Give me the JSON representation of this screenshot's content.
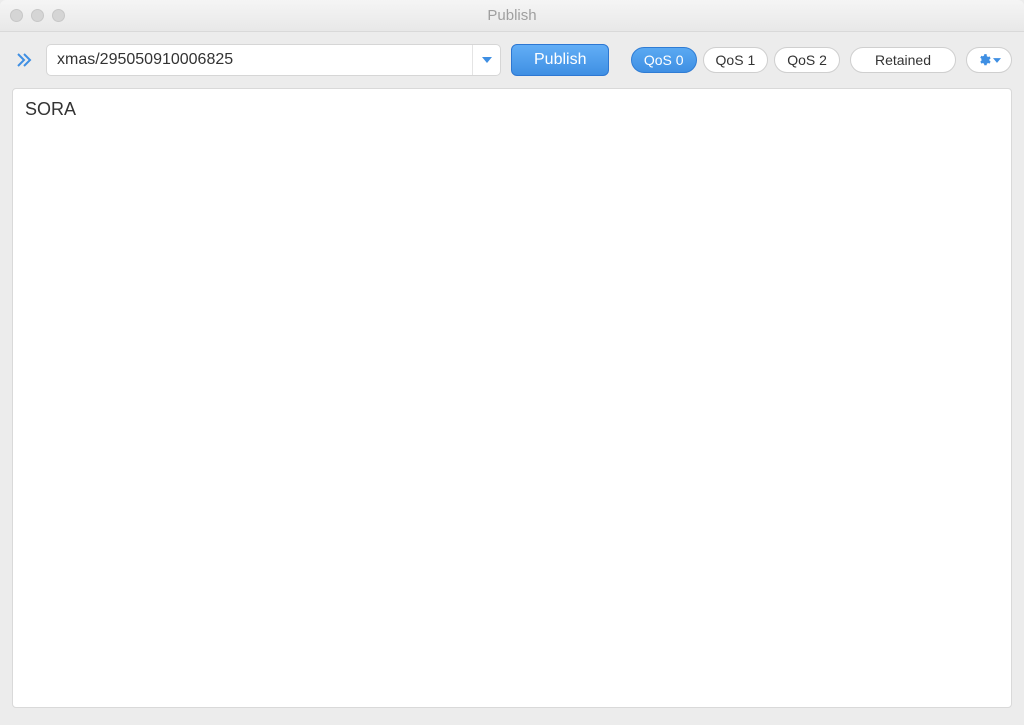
{
  "window": {
    "title": "Publish"
  },
  "toolbar": {
    "topic_value": "xmas/295050910006825",
    "publish_label": "Publish",
    "qos_options": [
      "QoS 0",
      "QoS 1",
      "QoS 2"
    ],
    "qos_selected_index": 0,
    "retained_label": "Retained"
  },
  "payload": {
    "text": "SORA"
  },
  "colors": {
    "accent": "#3f8fe3",
    "window_bg": "#ececec"
  }
}
